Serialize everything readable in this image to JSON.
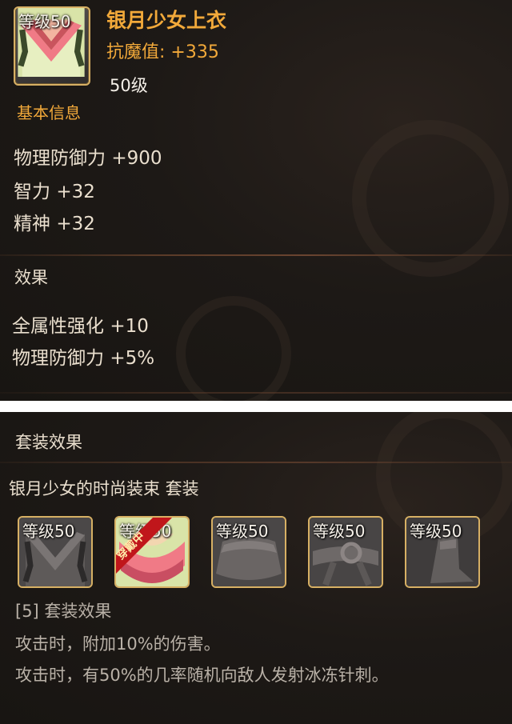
{
  "item": {
    "level_badge": "等级50",
    "name": "银月少女上衣",
    "resist_label": "抗魔值:",
    "resist_value": "+335",
    "required_level": "50级"
  },
  "basic_info": {
    "heading": "基本信息",
    "stats": [
      {
        "name": "物理防御力",
        "value": "+900"
      },
      {
        "name": "智力",
        "value": "+32"
      },
      {
        "name": "精神",
        "value": "+32"
      }
    ]
  },
  "effects": {
    "heading": "效果",
    "lines": [
      {
        "name": "全属性强化",
        "value": "+10"
      },
      {
        "name": "物理防御力",
        "value": "+5%"
      }
    ]
  },
  "set_section": {
    "heading": "套装效果",
    "set_name": "银月少女的时尚装束 套装",
    "items": [
      {
        "level_badge": "等级50",
        "equipped": false,
        "icon": "gray-cape-icon"
      },
      {
        "level_badge": "等级50",
        "equipped": true,
        "equipped_label": "穿戴中",
        "icon": "pink-top-icon"
      },
      {
        "level_badge": "等级50",
        "equipped": false,
        "icon": "gray-skirt-icon"
      },
      {
        "level_badge": "等级50",
        "equipped": false,
        "icon": "gray-belt-icon"
      },
      {
        "level_badge": "等级50",
        "equipped": false,
        "icon": "gray-boots-icon"
      }
    ],
    "bonus_title": "[5] 套装效果",
    "bonus_lines": [
      "攻击时，附加10%的伤害。",
      "攻击时，有50%的几率随机向敌人发射冰冻针刺。"
    ]
  },
  "colors": {
    "accent_gold": "#f2a93a",
    "text_cream": "#eadfce",
    "muted_gray": "#b9b1a7",
    "frame_gold": "#d7b064",
    "background": "#1c1815"
  }
}
